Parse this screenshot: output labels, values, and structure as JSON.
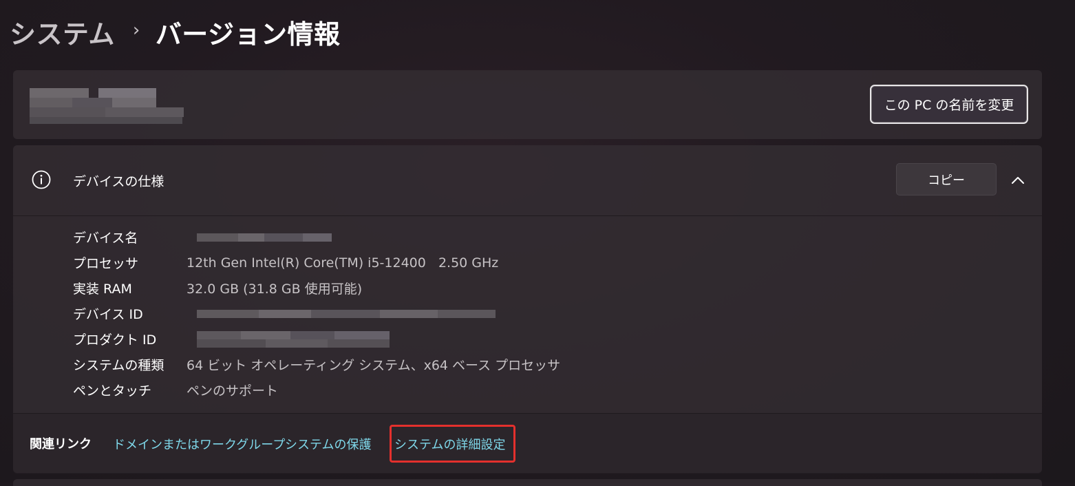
{
  "breadcrumb": {
    "parent": "システム",
    "separator": "›",
    "current": "バージョン情報"
  },
  "pc_name_card": {
    "rename_button": "この PC の名前を変更"
  },
  "device_spec": {
    "title": "デバイスの仕様",
    "copy_button": "コピー",
    "rows": [
      {
        "label": "デバイス名",
        "value": ""
      },
      {
        "label": "プロセッサ",
        "value": "12th Gen Intel(R) Core(TM) i5-12400   2.50 GHz"
      },
      {
        "label": "実装 RAM",
        "value": "32.0 GB (31.8 GB 使用可能)"
      },
      {
        "label": "デバイス ID",
        "value": ""
      },
      {
        "label": "プロダクト ID",
        "value": ""
      },
      {
        "label": "システムの種類",
        "value": "64 ビット オペレーティング システム、x64 ベース プロセッサ"
      },
      {
        "label": "ペンとタッチ",
        "value": "ペンのサポート"
      }
    ]
  },
  "related_links": {
    "label": "関連リンク",
    "links": [
      "ドメインまたはワークグループ",
      "システムの保護",
      "システムの詳細設定"
    ]
  },
  "colors": {
    "link": "#7fd8ea",
    "highlight": "#e4302d"
  },
  "icons": {
    "info": "info-icon",
    "collapse": "chevron-up-icon",
    "separator": "chevron-right-icon"
  }
}
